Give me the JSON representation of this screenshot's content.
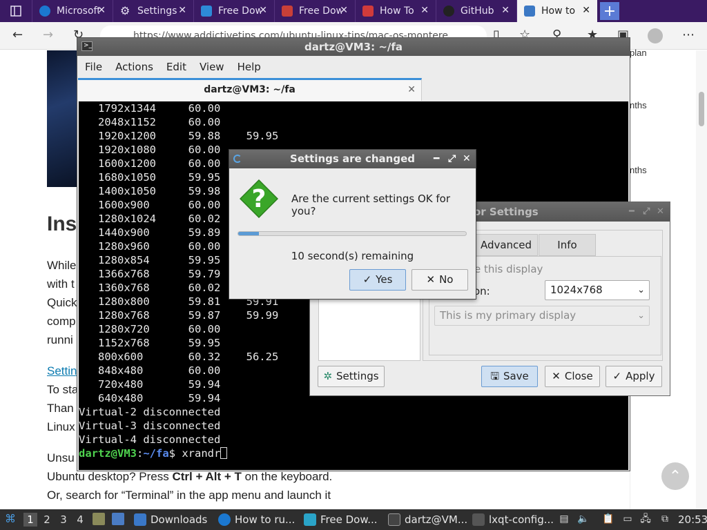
{
  "browser": {
    "tabs": [
      {
        "title": "Microsoft",
        "fav": "#1b78d0",
        "active": false
      },
      {
        "title": "Settings",
        "fav": "#777777",
        "active": false
      },
      {
        "title": "Free Dow",
        "fav": "#2d8ad8",
        "active": false
      },
      {
        "title": "Free Dow",
        "fav": "#c94038",
        "active": false
      },
      {
        "title": "How To",
        "fav": "#d13b3b",
        "active": false
      },
      {
        "title": "GitHub",
        "fav": "#222222",
        "active": false
      },
      {
        "title": "How to",
        "fav": "#3b78c4",
        "active": true
      }
    ],
    "url": "https://www.addictivetips.com/ubuntu-linux-tips/mac-os-montere"
  },
  "webpage": {
    "heading_fragment": "Ins",
    "paragraph1": [
      "While",
      "with t",
      "Quick",
      "comp",
      "runni"
    ],
    "settings_link": "Settin",
    "paragraph2": [
      "To sta",
      "Than",
      "Linux"
    ],
    "unsu_line": "Unsu",
    "line_ctrl_prefix": "Ubuntu desktop? Press ",
    "line_ctrl_keys": "Ctrl + Alt + T",
    "line_ctrl_suffix": " on the keyboard.",
    "line_or": "Or, search for “Terminal” in the app menu and launch it",
    "side_text": [
      "plan",
      "nths",
      "nths"
    ]
  },
  "terminal": {
    "title": "dartz@VM3: ~/fa",
    "menu": [
      "File",
      "Actions",
      "Edit",
      "View",
      "Help"
    ],
    "tab_title": "dartz@VM3: ~/fa",
    "lines": [
      "   1792x1344     60.00",
      "   2048x1152     60.00",
      "   1920x1200     59.88    59.95",
      "   1920x1080     60.00",
      "   1600x1200     60.00",
      "   1680x1050     59.95",
      "   1400x1050     59.98",
      "   1600x900      60.00",
      "   1280x1024     60.02",
      "   1440x900      59.89",
      "   1280x960      60.00",
      "   1280x854      59.95",
      "   1366x768      59.79",
      "   1360x768      60.02",
      "   1280x800      59.81    59.91",
      "   1280x768      59.87    59.99",
      "   1280x720      60.00",
      "   1152x768      59.95",
      "   800x600       60.32    56.25",
      "   848x480       60.00",
      "   720x480       59.94",
      "   640x480       59.94",
      "Virtual-2 disconnected",
      "Virtual-3 disconnected",
      "Virtual-4 disconnected"
    ],
    "prompt_user": "dartz@VM3",
    "prompt_sep": ":",
    "prompt_path": "~/fa",
    "prompt_end": "$ ",
    "command": "xrandr"
  },
  "monitor": {
    "title_fragment": "or Settings",
    "tabs": [
      "Advanced",
      "Info"
    ],
    "use_display_fragment": "e this display",
    "resolution_label_fragment": "on:",
    "resolution_value": "1024x768",
    "primary_value": "This is my primary display",
    "buttons": {
      "settings": "Settings",
      "save": "Save",
      "close": "Close",
      "apply": "Apply"
    }
  },
  "dialog": {
    "title": "Settings are changed",
    "question": "Are the current settings OK for you?",
    "progress": 0.09,
    "remaining": "10 second(s) remaining",
    "yes": "Yes",
    "no": "No"
  },
  "taskbar": {
    "workspaces": [
      "1",
      "2",
      "3",
      "4"
    ],
    "tasks": [
      {
        "label": "Downloads",
        "color": "#3a78c8"
      },
      {
        "label": "How to ru...",
        "color": "#1b78d0"
      },
      {
        "label": "Free Dow...",
        "color": "#2aa4c8"
      },
      {
        "label": "dartz@VM...",
        "color": "#444444"
      },
      {
        "label": "lxqt-config...",
        "color": "#555555"
      }
    ],
    "clock": "20:53"
  }
}
